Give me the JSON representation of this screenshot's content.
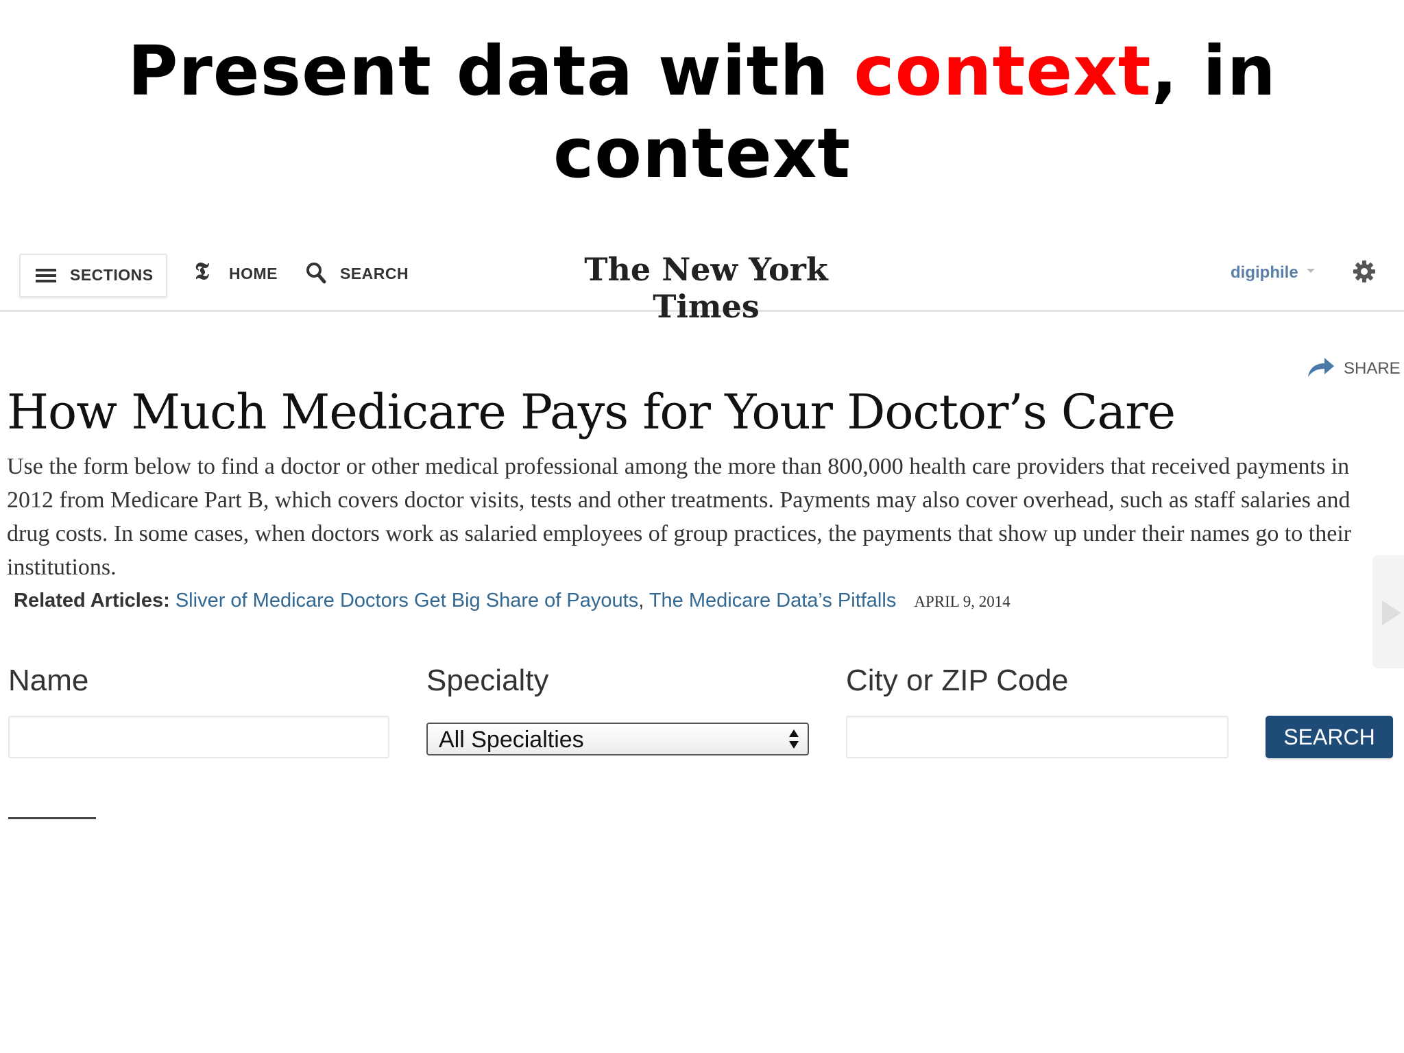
{
  "slide": {
    "title_before": "Present data with ",
    "title_accent": "context",
    "title_after": ", in context"
  },
  "nav": {
    "sections_label": "SECTIONS",
    "home_label": "HOME",
    "search_label": "SEARCH",
    "logo_text": "The New York Times",
    "username": "digiphile"
  },
  "article": {
    "share_label": "SHARE",
    "headline": "How Much Medicare Pays for Your Doctor’s Care",
    "summary": "Use the form below to find a doctor or other medical professional among the more than 800,000 health care providers that received payments in 2012 from Medicare Part B, which covers doctor visits, tests and other treatments. Payments may also cover overhead, such as staff salaries and drug costs. In some cases, when doctors work as salaried employees of group practices, the payments that show up under their names go to their institutions.",
    "related_label": "Related Articles:",
    "related_links": [
      "Sliver of Medicare Doctors Get Big Share of Payouts",
      "The Medicare Data’s Pitfalls"
    ],
    "related_separator": ",",
    "date": "APRIL 9, 2014"
  },
  "form": {
    "name_label": "Name",
    "name_value": "",
    "specialty_label": "Specialty",
    "specialty_selected": "All Specialties",
    "location_label": "City or ZIP Code",
    "location_value": "",
    "search_button": "SEARCH"
  },
  "colors": {
    "accent_red": "#ff0000",
    "link_blue": "#326891",
    "button_blue": "#1f4b78",
    "username_blue": "#5a7fa8"
  },
  "icons": [
    "hamburger-icon",
    "t-logo-icon",
    "search-icon",
    "gear-icon",
    "share-arrow-icon",
    "caret-down-icon",
    "select-arrows-icon",
    "next-arrow-icon"
  ]
}
